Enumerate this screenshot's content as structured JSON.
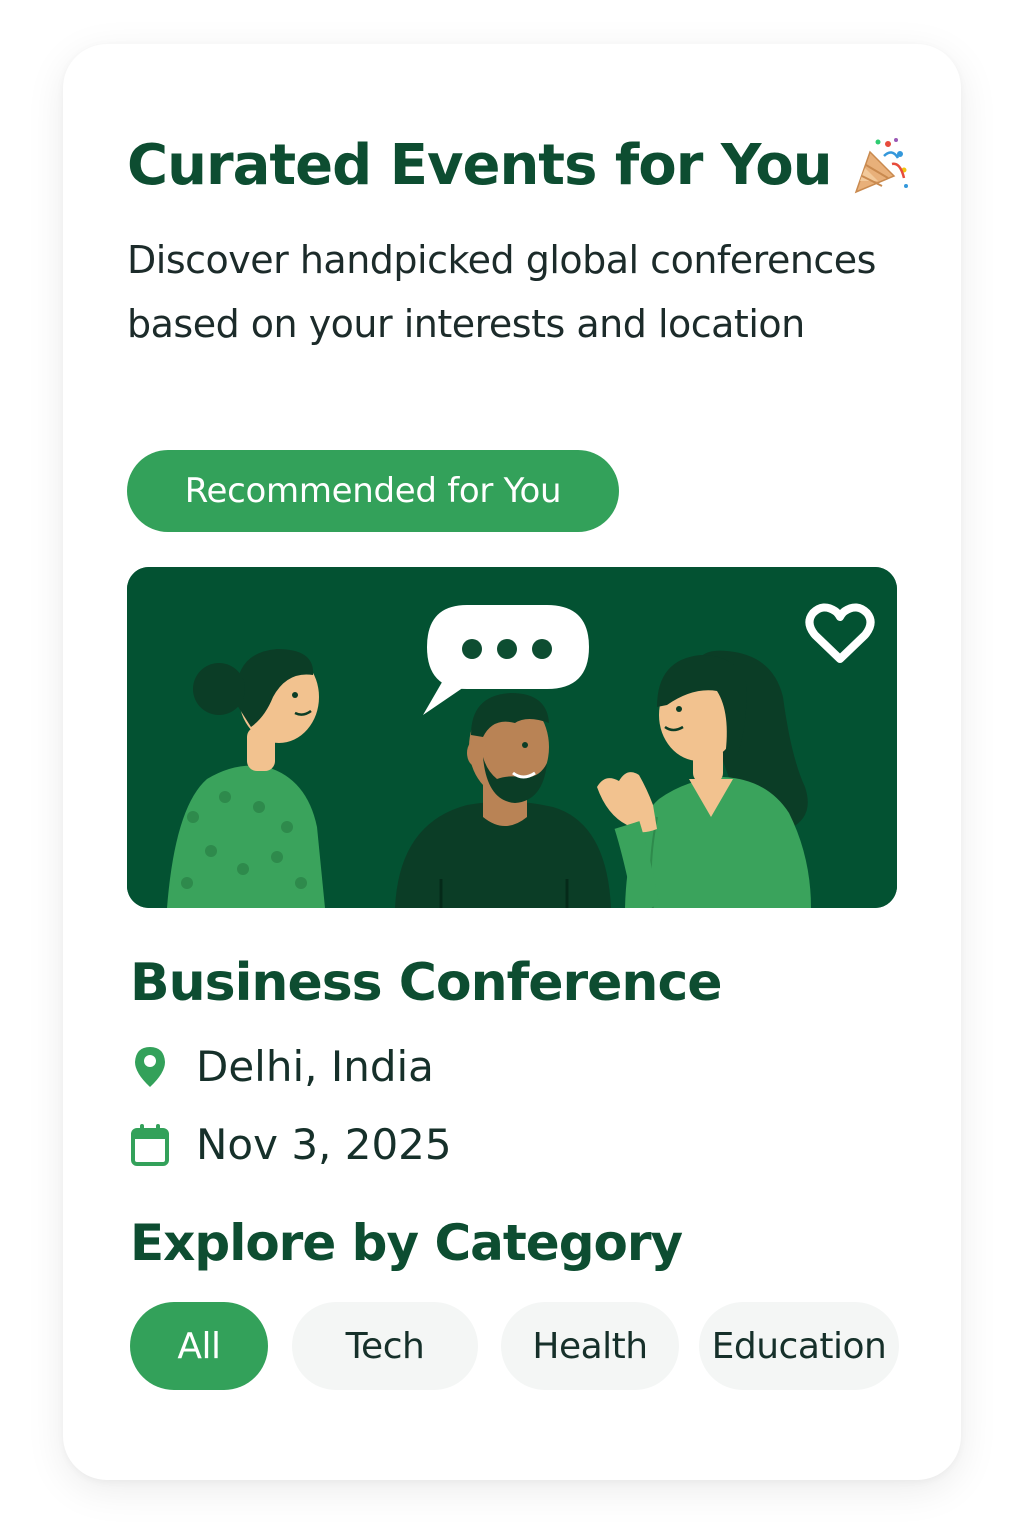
{
  "header": {
    "title": "Curated Events for You",
    "title_icon": "party-popper-icon",
    "subtitle": "Discover handpicked global conferences based on your interests and location"
  },
  "badge": {
    "label": "Recommended for You"
  },
  "event": {
    "image_icon": "people-conversation-illustration",
    "favorite_icon": "heart-icon",
    "title": "Business Conference",
    "location_icon": "location-pin-icon",
    "location": "Delhi, India",
    "date_icon": "calendar-icon",
    "date": "Nov 3, 2025"
  },
  "categories": {
    "title": "Explore by Category",
    "items": [
      {
        "label": "All",
        "active": true
      },
      {
        "label": "Tech",
        "active": false
      },
      {
        "label": "Health",
        "active": false
      },
      {
        "label": "Education",
        "active": false
      }
    ]
  },
  "colors": {
    "primary_dark": "#0d4d31",
    "accent_green": "#33a15a",
    "hero_bg": "#035232",
    "chip_bg": "#f4f6f5"
  }
}
